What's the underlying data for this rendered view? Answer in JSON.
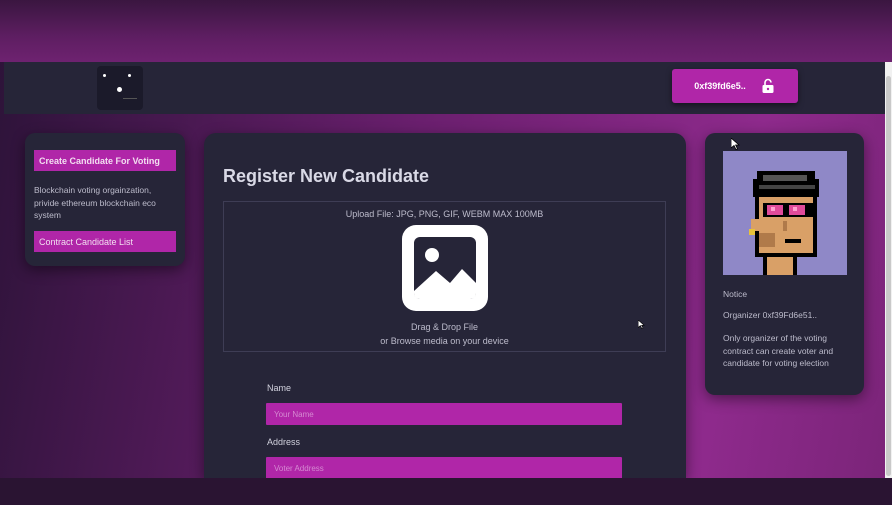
{
  "navbar": {
    "wallet_address": "0xf39fd6e5..",
    "logo_icon": "robot-face-logo",
    "wallet_icon": "unlock-icon"
  },
  "sidebar": {
    "create_button": "Create Candidate For Voting",
    "description": "Blockchain voting orgainzation, privide ethereum blockchain eco system",
    "list_button": "Contract Candidate List"
  },
  "main": {
    "title": "Register New Candidate",
    "upload_label": "Upload File: JPG, PNG, GIF, WEBM MAX 100MB",
    "upload_icon": "image-icon",
    "drag_text": "Drag & Drop File",
    "browse_text": "or Browse media on your device",
    "name_label": "Name",
    "name_placeholder": "Your Name",
    "name_value": "",
    "address_label": "Address",
    "address_placeholder": "Voter Address",
    "address_value": ""
  },
  "notice": {
    "title": "Notice",
    "organizer": "Organizer 0xf39Fd6e51..",
    "description": "Only organizer of the voting contract can create voter and candidate for voting election"
  },
  "colors": {
    "accent": "#b026a8",
    "card": "#262538",
    "avatar_bg": "#8f88c7"
  }
}
